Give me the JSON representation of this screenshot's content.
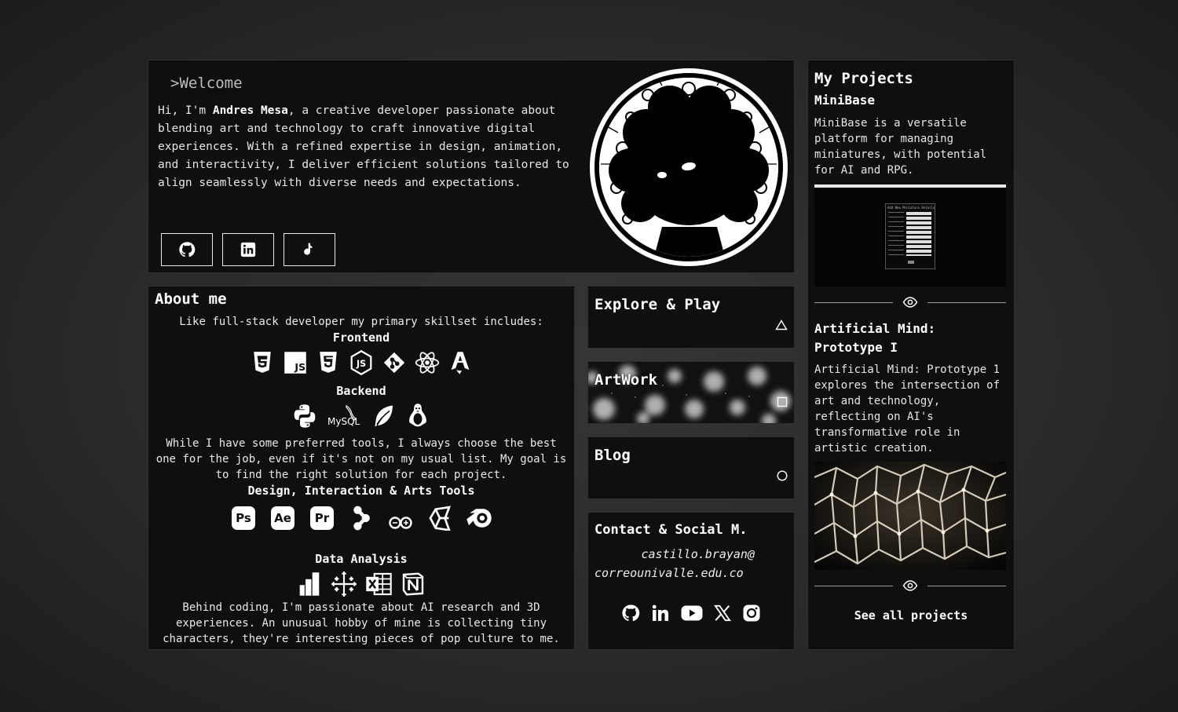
{
  "welcome": {
    "heading": ">Welcome",
    "intro_prefix": "Hi, I'm ",
    "name": "Andres Mesa",
    "intro_suffix": ", a creative developer passionate about blending art and technology to craft innovative digital experiences. With a refined expertise in design, animation, and interactivity, I deliver efficient solutions tailored to align seamlessly with diverse needs and expectations.",
    "social_buttons": [
      "github-icon",
      "linkedin-icon",
      "music-note-icon"
    ]
  },
  "about": {
    "title": "About me",
    "lead": "Like full-stack developer my primary skillset includes:",
    "frontend_label": "Frontend",
    "frontend_icons": [
      "css3-icon",
      "javascript-icon",
      "html5-icon",
      "nodejs-icon",
      "git-icon",
      "react-icon",
      "astro-icon"
    ],
    "backend_label": "Backend",
    "backend_icons": [
      "python-icon",
      "mysql-icon",
      "feather-icon",
      "linux-icon"
    ],
    "mysql_text": "MySQL",
    "tools_para": "While I have some preferred tools, I always choose the best one for the job, even if it's not on my usual list. My goal is to find the right solution for each project.",
    "design_label": "Design, Interaction & Arts Tools",
    "design_icons": [
      "photoshop-icon",
      "after-effects-icon",
      "premiere-icon",
      "share-icon",
      "arduino-icon",
      "unity-icon",
      "blender-icon"
    ],
    "ps": "Ps",
    "ae": "Ae",
    "pr": "Pr",
    "data_label": "Data Analysis",
    "data_icons": [
      "powerbi-icon",
      "tableau-icon",
      "excel-icon",
      "notion-icon"
    ],
    "hobby_para": "Behind coding, I'm passionate about AI research and 3D experiences. An unusual hobby of mine is collecting tiny characters, they're interesting pieces of pop culture to me."
  },
  "nav_cards": {
    "explore": "Explore & Play",
    "artwork": "ArtWork",
    "blog": "Blog"
  },
  "contact": {
    "title": "Contact & Social M.",
    "email_line1": "castillo.brayan@",
    "email_line2": "correounivalle.edu.co",
    "icons": [
      "github-icon",
      "linkedin-icon",
      "youtube-icon",
      "x-icon",
      "instagram-icon"
    ]
  },
  "projects": {
    "title": "My Projects",
    "items": [
      {
        "name": "MiniBase",
        "description": "MiniBase is a versatile platform for managing miniatures, with potential for AI and RPG.",
        "preview_heading": "Add New Miniature Details"
      },
      {
        "name": "Artificial Mind: Prototype I",
        "description": "Artificial Mind: Prototype 1 explores the intersection of art and technology, reflecting on AI's transformative role in artistic creation."
      }
    ],
    "see_all": "See all projects"
  },
  "colors": {
    "background": "#2a2a2a",
    "card": "#0f0f0f",
    "text": "#e8e8e8"
  }
}
